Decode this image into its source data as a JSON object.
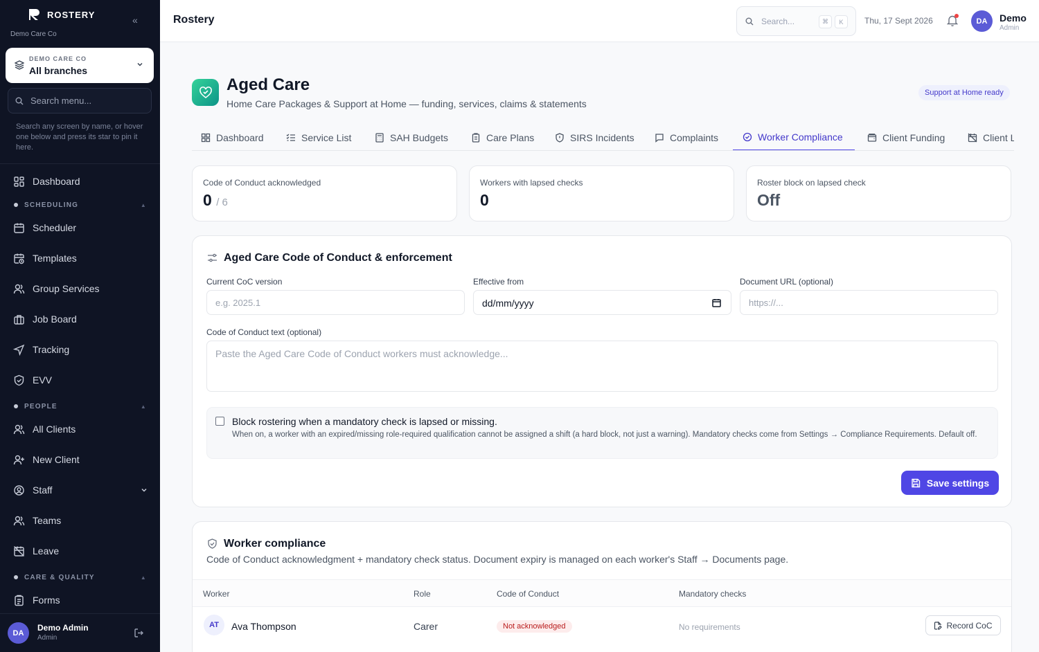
{
  "sidebar": {
    "brand": "ROSTERY",
    "org": "Demo Care Co",
    "branch": {
      "org_label": "DEMO CARE CO",
      "label": "All branches"
    },
    "search_placeholder": "Search menu...",
    "search_hint": "Search any screen by name, or hover one below and press its star to pin it here.",
    "items": {
      "dashboard": "Dashboard",
      "section_scheduling": "SCHEDULING",
      "scheduler": "Scheduler",
      "templates": "Templates",
      "group_services": "Group Services",
      "job_board": "Job Board",
      "tracking": "Tracking",
      "evv": "EVV",
      "section_people": "PEOPLE",
      "all_clients": "All Clients",
      "new_client": "New Client",
      "staff": "Staff",
      "teams": "Teams",
      "leave": "Leave",
      "section_care": "CARE & QUALITY",
      "forms": "Forms"
    },
    "user": {
      "initials": "DA",
      "name": "Demo Admin",
      "role": "Admin"
    }
  },
  "topbar": {
    "title": "Rostery",
    "search_placeholder": "Search...",
    "kbd1": "⌘",
    "kbd2": "K",
    "date": "Thu, 17 Sept 2026",
    "user": {
      "initials": "DA",
      "name": "Demo",
      "role": "Admin"
    }
  },
  "page": {
    "title": "Aged Care",
    "subtitle": "Home Care Packages & Support at Home — funding, services, claims & statements",
    "badge": "Support at Home ready"
  },
  "tabs": [
    {
      "label": "Dashboard",
      "icon": "grid-icon"
    },
    {
      "label": "Service List",
      "icon": "list-check-icon"
    },
    {
      "label": "SAH Budgets",
      "icon": "calculator-icon"
    },
    {
      "label": "Care Plans",
      "icon": "clipboard-icon"
    },
    {
      "label": "SIRS Incidents",
      "icon": "shield-alert-icon"
    },
    {
      "label": "Complaints",
      "icon": "message-icon"
    },
    {
      "label": "Worker Compliance",
      "icon": "check-circle-icon"
    },
    {
      "label": "Client Funding",
      "icon": "wallet-icon"
    },
    {
      "label": "Client L",
      "icon": "calendar-off-icon"
    }
  ],
  "active_tab": "Worker Compliance",
  "stats": [
    {
      "label": "Code of Conduct acknowledged",
      "value": "0",
      "denominator": "/ 6"
    },
    {
      "label": "Workers with lapsed checks",
      "value": "0"
    },
    {
      "label": "Roster block on lapsed check",
      "value": "Off"
    }
  ],
  "coc": {
    "title": "Aged Care Code of Conduct & enforcement",
    "version_label": "Current CoC version",
    "version_placeholder": "e.g. 2025.1",
    "effective_label": "Effective from",
    "effective_value": "dd/mm/yyyy",
    "url_label": "Document URL (optional)",
    "url_placeholder": "https://...",
    "text_label": "Code of Conduct text (optional)",
    "text_placeholder": "Paste the Aged Care Code of Conduct workers must acknowledge...",
    "block_title": "Block rostering when a mandatory check is lapsed or missing.",
    "block_desc": "When on, a worker with an expired/missing role-required qualification cannot be assigned a shift (a hard block, not just a warning). Mandatory checks come from Settings → Compliance Requirements. Default off.",
    "save_label": "Save settings"
  },
  "compliance": {
    "title": "Worker compliance",
    "description": "Code of Conduct acknowledgment + mandatory check status. Document expiry is managed on each worker's Staff → Documents page.",
    "columns": [
      "Worker",
      "Role",
      "Code of Conduct",
      "Mandatory checks"
    ],
    "rows": [
      {
        "initials": "AT",
        "name": "Ava Thompson",
        "role": "Carer",
        "coc_status": "Not acknowledged",
        "checks": "No requirements",
        "action": "Record CoC"
      }
    ]
  },
  "colors": {
    "accent": "#4f46e5",
    "sidebar_bg": "#0f1424",
    "brand_gradient_start": "#34d399",
    "danger": "#b91c1c"
  }
}
